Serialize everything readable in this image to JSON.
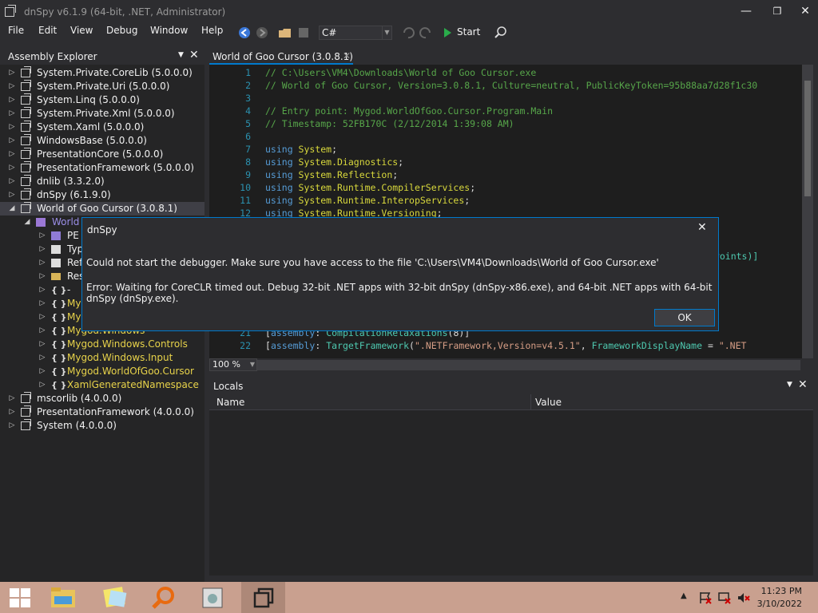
{
  "window": {
    "title": "dnSpy v6.1.9 (64-bit, .NET, Administrator)",
    "minimize": "—",
    "maximize": "❐",
    "close": "✕"
  },
  "menu": [
    "File",
    "Edit",
    "View",
    "Debug",
    "Window",
    "Help"
  ],
  "toolbar": {
    "language": "C#",
    "start_label": "Start"
  },
  "assembly_explorer": {
    "title": "Assembly Explorer",
    "items": [
      {
        "label": "System.Private.CoreLib (5.0.0.0)",
        "indent": 0,
        "expand": "▷",
        "icon": "asm"
      },
      {
        "label": "System.Private.Uri (5.0.0.0)",
        "indent": 0,
        "expand": "▷",
        "icon": "asm"
      },
      {
        "label": "System.Linq (5.0.0.0)",
        "indent": 0,
        "expand": "▷",
        "icon": "asm"
      },
      {
        "label": "System.Private.Xml (5.0.0.0)",
        "indent": 0,
        "expand": "▷",
        "icon": "asm"
      },
      {
        "label": "System.Xaml (5.0.0.0)",
        "indent": 0,
        "expand": "▷",
        "icon": "asm"
      },
      {
        "label": "WindowsBase (5.0.0.0)",
        "indent": 0,
        "expand": "▷",
        "icon": "asm"
      },
      {
        "label": "PresentationCore (5.0.0.0)",
        "indent": 0,
        "expand": "▷",
        "icon": "asm"
      },
      {
        "label": "PresentationFramework (5.0.0.0)",
        "indent": 0,
        "expand": "▷",
        "icon": "asm"
      },
      {
        "label": "dnlib (3.3.2.0)",
        "indent": 0,
        "expand": "▷",
        "icon": "asm"
      },
      {
        "label": "dnSpy (6.1.9.0)",
        "indent": 0,
        "expand": "▷",
        "icon": "asm"
      },
      {
        "label": "World of Goo Cursor (3.0.8.1)",
        "indent": 0,
        "expand": "◢",
        "icon": "asm",
        "selected": true
      },
      {
        "label": "World of Goo Cursor.exe",
        "indent": 1,
        "expand": "◢",
        "icon": "mod",
        "yellow": false,
        "blue": true
      },
      {
        "label": "PE",
        "indent": 2,
        "expand": "▷",
        "icon": "pe"
      },
      {
        "label": "Type References",
        "indent": 2,
        "expand": "▷",
        "icon": "ref"
      },
      {
        "label": "References",
        "indent": 2,
        "expand": "▷",
        "icon": "ref"
      },
      {
        "label": "Resources",
        "indent": 2,
        "expand": "▷",
        "icon": "folder"
      },
      {
        "label": "-",
        "indent": 2,
        "expand": "▷",
        "icon": "ns"
      },
      {
        "label": "Mygod",
        "indent": 2,
        "expand": "▷",
        "icon": "ns",
        "yellow": true
      },
      {
        "label": "Mygod.Net",
        "indent": 2,
        "expand": "▷",
        "icon": "ns",
        "yellow": true
      },
      {
        "label": "Mygod.Windows",
        "indent": 2,
        "expand": "▷",
        "icon": "ns",
        "yellow": true
      },
      {
        "label": "Mygod.Windows.Controls",
        "indent": 2,
        "expand": "▷",
        "icon": "ns",
        "yellow": true
      },
      {
        "label": "Mygod.Windows.Input",
        "indent": 2,
        "expand": "▷",
        "icon": "ns",
        "yellow": true
      },
      {
        "label": "Mygod.WorldOfGoo.Cursor",
        "indent": 2,
        "expand": "▷",
        "icon": "ns",
        "yellow": true
      },
      {
        "label": "XamlGeneratedNamespace",
        "indent": 2,
        "expand": "▷",
        "icon": "ns",
        "yellow": true
      },
      {
        "label": "mscorlib (4.0.0.0)",
        "indent": 0,
        "expand": "▷",
        "icon": "asm"
      },
      {
        "label": "PresentationFramework (4.0.0.0)",
        "indent": 0,
        "expand": "▷",
        "icon": "asm"
      },
      {
        "label": "System (4.0.0.0)",
        "indent": 0,
        "expand": "▷",
        "icon": "asm"
      }
    ]
  },
  "document_tab": {
    "title": "World of Goo Cursor (3.0.8.1)",
    "close": "✕"
  },
  "code": [
    {
      "n": "1",
      "parts": [
        [
          "comment",
          "// C:\\Users\\VM4\\Downloads\\World of Goo Cursor.exe"
        ]
      ]
    },
    {
      "n": "2",
      "parts": [
        [
          "comment",
          "// World of Goo Cursor, Version=3.0.8.1, Culture=neutral, PublicKeyToken=95b88aa7d28f1c30"
        ]
      ]
    },
    {
      "n": "3",
      "parts": []
    },
    {
      "n": "4",
      "parts": [
        [
          "comment",
          "// Entry point: Mygod.WorldOfGoo.Cursor.Program.Main"
        ]
      ]
    },
    {
      "n": "5",
      "parts": [
        [
          "comment",
          "// Timestamp: 52FB170C (2/12/2014 1:39:08 AM)"
        ]
      ]
    },
    {
      "n": "6",
      "parts": []
    },
    {
      "n": "7",
      "parts": [
        [
          "kw",
          "using "
        ],
        [
          "ns-c",
          "System"
        ],
        [
          "txt",
          ";"
        ]
      ]
    },
    {
      "n": "8",
      "parts": [
        [
          "kw",
          "using "
        ],
        [
          "ns-c",
          "System.Diagnostics"
        ],
        [
          "txt",
          ";"
        ]
      ]
    },
    {
      "n": "9",
      "parts": [
        [
          "kw",
          "using "
        ],
        [
          "ns-c",
          "System.Reflection"
        ],
        [
          "txt",
          ";"
        ]
      ]
    },
    {
      "n": "10",
      "parts": [
        [
          "kw",
          "using "
        ],
        [
          "ns-c",
          "System.Runtime.CompilerServices"
        ],
        [
          "txt",
          ";"
        ]
      ]
    },
    {
      "n": "11",
      "parts": [
        [
          "kw",
          "using "
        ],
        [
          "ns-c",
          "System.Runtime.InteropServices"
        ],
        [
          "txt",
          ";"
        ]
      ]
    },
    {
      "n": "12",
      "parts": [
        [
          "kw",
          "using "
        ],
        [
          "ns-c",
          "System.Runtime.Versioning"
        ],
        [
          "txt",
          ";"
        ]
      ]
    },
    {
      "n": "21",
      "parts": [
        [
          "txt",
          "["
        ],
        [
          "kw",
          "assembly"
        ],
        [
          "txt",
          ": "
        ],
        [
          "typ",
          "CompilationRelaxations"
        ],
        [
          "txt",
          "(8)]"
        ]
      ]
    },
    {
      "n": "22",
      "parts": [
        [
          "txt",
          "["
        ],
        [
          "kw",
          "assembly"
        ],
        [
          "txt",
          ": "
        ],
        [
          "typ",
          "TargetFramework"
        ],
        [
          "txt",
          "("
        ],
        [
          "str",
          "\".NETFramework,Version=v4.5.1\""
        ],
        [
          "txt",
          ", "
        ],
        [
          "typ",
          "FrameworkDisplayName"
        ],
        [
          "txt",
          " = "
        ],
        [
          "str",
          "\".NET"
        ]
      ]
    }
  ],
  "code_partial_right": "ePoints)]",
  "zoom": "100 %",
  "locals": {
    "title": "Locals",
    "col_name": "Name",
    "col_value": "Value"
  },
  "dialog": {
    "title": "dnSpy",
    "message1": "Could not start the debugger. Make sure you have access to the file 'C:\\Users\\VM4\\Downloads\\World of Goo Cursor.exe'",
    "message2": "Error: Waiting for CoreCLR timed out. Debug 32-bit .NET apps with 32-bit dnSpy (dnSpy-x86.exe), and 64-bit .NET apps with 64-bit dnSpy (dnSpy.exe).",
    "ok": "OK",
    "close": "✕"
  },
  "taskbar": {
    "time": "11:23 PM",
    "date": "3/10/2022"
  }
}
